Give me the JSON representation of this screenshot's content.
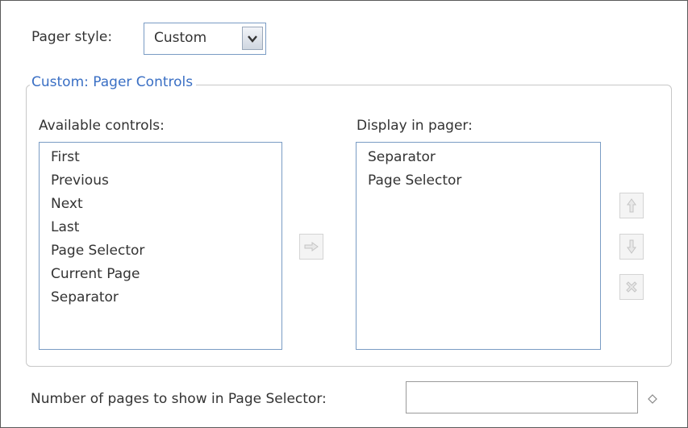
{
  "pager_style": {
    "label": "Pager style:",
    "value": "Custom"
  },
  "pager_controls": {
    "legend": "Custom: Pager Controls",
    "available": {
      "label": "Available controls:",
      "items": [
        "First",
        "Previous",
        "Next",
        "Last",
        "Page Selector",
        "Current Page",
        "Separator"
      ]
    },
    "display": {
      "label": "Display in pager:",
      "items": [
        "Separator",
        "Page Selector"
      ]
    }
  },
  "pages_to_show": {
    "label": "Number of pages to show in Page Selector:",
    "value": ""
  },
  "icons": {
    "dropdown": "chevron-down-icon",
    "add": "arrow-right-icon",
    "up": "arrow-up-icon",
    "down": "arrow-down-icon",
    "remove": "x-icon",
    "hint": "diamond-icon"
  },
  "colors": {
    "legend": "#3a6fc4",
    "input_border": "#7a9cc4",
    "disabled_icon": "#c4c4c4"
  }
}
